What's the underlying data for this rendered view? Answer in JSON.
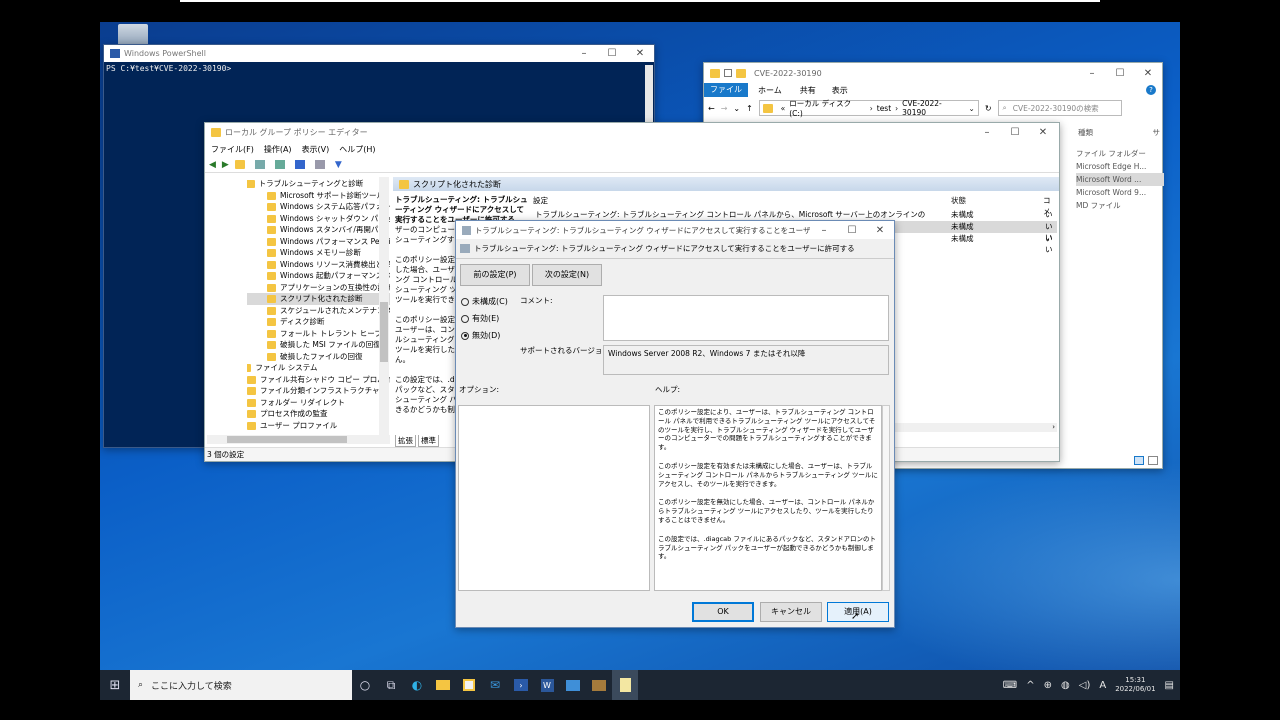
{
  "powershell": {
    "title": "Windows PowerShell",
    "prompt": "PS C:¥test¥CVE-2022-30190>"
  },
  "explorer": {
    "title": "CVE-2022-30190",
    "ribbon_tabs": [
      "ファイル",
      "ホーム",
      "共有",
      "表示"
    ],
    "address": [
      "«",
      "ローカル ディスク (C:)",
      "›",
      "test",
      "›",
      "CVE-2022-30190"
    ],
    "search_placeholder": "CVE-2022-30190の検索",
    "col_type": "種類",
    "col_size": "サ",
    "types": [
      "ファイル フォルダー",
      "Microsoft Edge H...",
      "Microsoft Word ...",
      "Microsoft Word 9...",
      "MD ファイル"
    ]
  },
  "gpedit": {
    "title": "ローカル グループ ポリシー エディター",
    "menu": [
      "ファイル(F)",
      "操作(A)",
      "表示(V)",
      "ヘルプ(H)"
    ],
    "tree": [
      "トラブルシューティングと診断",
      "Microsoft サポート診断ツール",
      "Windows システム応答パフォー",
      "Windows シャットダウン パフォー",
      "Windows スタンバイ/再開パフ",
      "Windows パフォーマンス PerfTr",
      "Windows メモリー診断",
      "Windows リソース消費検出と解",
      "Windows 起動パフォーマンス診",
      "アプリケーションの互換性の診断",
      "スクリプト化された診断",
      "スケジュールされたメンテナンス",
      "ディスク診断",
      "フォールト トレラント ヒープ",
      "破損した MSI ファイルの回復",
      "破損したファイルの回復",
      "ファイル システム",
      "ファイル共有シャドウ コピー プロバイダ",
      "ファイル分類インフラストラクチャ",
      "フォルダー リダイレクト",
      "プロセス作成の監査",
      "ユーザー プロファイル"
    ],
    "panel_header": "スクリプト化された診断",
    "desc_title": "トラブルシューティング: トラブルシューティング ウィザードにアクセスして実行することをユーザーに許可する",
    "desc_lines": [
      "ザーのコンピューター",
      "シューティングする"
    ],
    "desc_block1": [
      "このポリシー設定を",
      "した場合、ユーザーは",
      "ング コントロール パネ",
      "シューティング ツール",
      "ツールを実行できます"
    ],
    "desc_block2": [
      "このポリシー設定を",
      "ユーザーは、コントロ",
      "ルシューティング ツー",
      "ツールを実行したり",
      "ん。"
    ],
    "desc_block3": [
      "この設定では、.diag",
      "パックなど、スタンド",
      "シューティング パック",
      "きるかどうかも制御"
    ],
    "col_setting": "設定",
    "col_state": "状態",
    "col_comment": "コメ",
    "rows": [
      {
        "setting": "トラブルシューティング: トラブルシューティング コントロール パネルから、Microsoft サーバー上のオンラインのトラブルシューティング コ...",
        "state": "未構成",
        "comment": "いい"
      },
      {
        "setting": "",
        "state": "未構成",
        "comment": "いい"
      },
      {
        "setting": "",
        "state": "未構成",
        "comment": "いい"
      }
    ],
    "tabs": [
      "拡張",
      "標準"
    ],
    "status": "3 個の設定"
  },
  "dialog": {
    "title": "トラブルシューティング: トラブルシューティング ウィザードにアクセスして実行することをユーザーに許可する",
    "header": "トラブルシューティング: トラブルシューティング ウィザードにアクセスして実行することをユーザーに許可する",
    "prev_btn": "前の設定(P)",
    "next_btn": "次の設定(N)",
    "radios": [
      "未構成(C)",
      "有効(E)",
      "無効(D)"
    ],
    "selected_radio": "無効(D)",
    "comment_label": "コメント:",
    "supported_label": "サポートされるバージョン:",
    "supported_value": "Windows Server 2008 R2、Windows 7 またはそれ以降",
    "options_label": "オプション:",
    "help_label": "ヘルプ:",
    "help": [
      "このポリシー設定により、ユーザーは、トラブルシューティング コントロール パネルで利用できるトラブルシューティング ツールにアクセスしてそのツールを実行し、トラブルシューティング ウィザードを実行してユーザーのコンピューターでの問題をトラブルシューティングすることができます。",
      "このポリシー設定を有効または未構成にした場合、ユーザーは、トラブルシューティング コントロール パネルからトラブルシューティング ツールにアクセスし、そのツールを実行できます。",
      "このポリシー設定を無効にした場合、ユーザーは、コントロール パネルからトラブルシューティング ツールにアクセスしたり、ツールを実行したりすることはできません。",
      "この設定では、.diagcab ファイルにあるパックなど、スタンドアロンのトラブルシューティング パックをユーザーが起動できるかどうかも制御します。"
    ],
    "ok": "OK",
    "cancel": "キャンセル",
    "apply": "適用(A)"
  },
  "taskbar": {
    "search_placeholder": "ここに入力して検索",
    "time": "15:31",
    "date": "2022/06/01",
    "ime": "A",
    "pinned": [
      "cortana-icon",
      "task-view-icon",
      "edge-icon",
      "file-explorer-icon",
      "store-icon",
      "mail-icon",
      "powershell-icon",
      "word-icon",
      "control-panel-icon",
      "winrar-icon",
      "notepad-icon"
    ]
  },
  "colors": {
    "accent": "#0078d7",
    "taskbar": "#1c2633",
    "desktop": "#0b5fc7",
    "powershell_bg": "#012456"
  }
}
